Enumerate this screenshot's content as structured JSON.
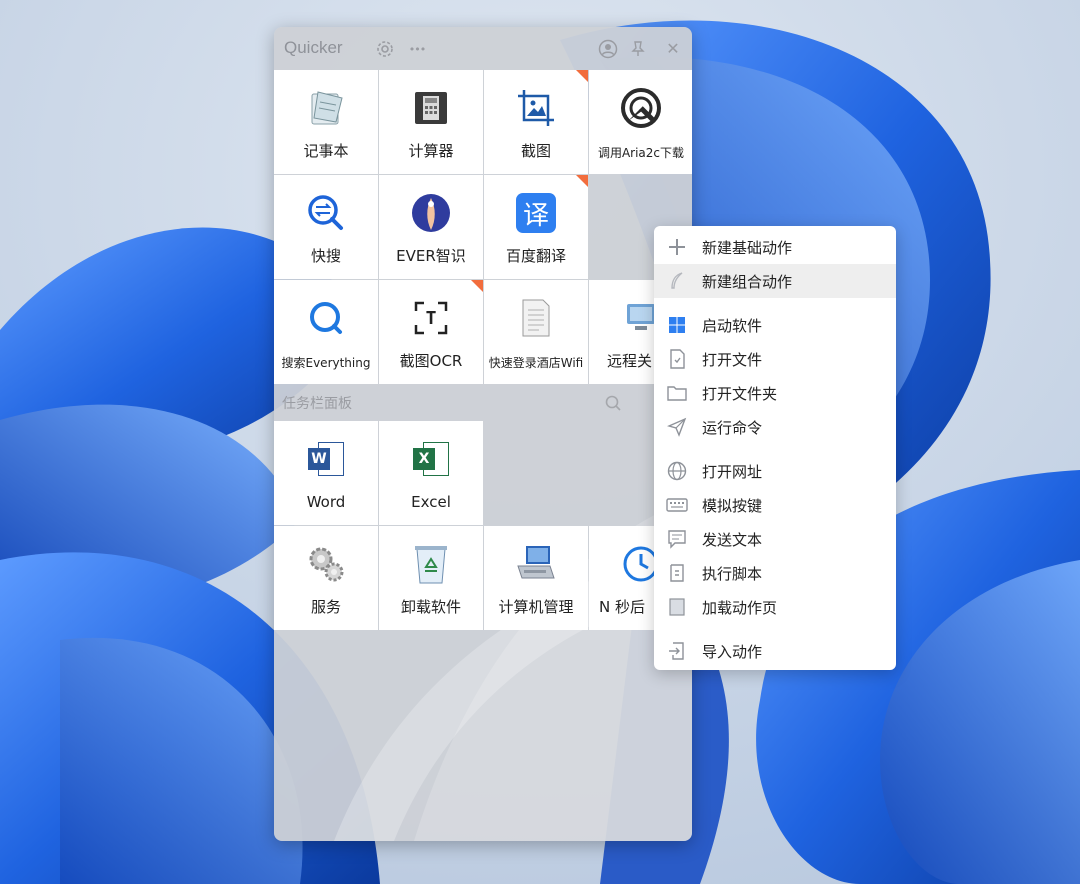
{
  "window": {
    "title": "Quicker",
    "icons": [
      "gear-icon",
      "more-icon",
      "profile-icon",
      "pin-icon",
      "close-icon"
    ],
    "more_glyph": "•••",
    "close_glyph": "✕"
  },
  "actions": [
    {
      "label": "记事本",
      "icon": "notepad-icon"
    },
    {
      "label": "计算器",
      "icon": "calculator-icon"
    },
    {
      "label": "截图",
      "icon": "screenshot-icon"
    },
    {
      "label": "调用Aria2c下载",
      "icon": "aria2c-download-icon"
    },
    {
      "label": "快搜",
      "icon": "quick-search-icon"
    },
    {
      "label": "EVER智识",
      "icon": "ever-icon"
    },
    {
      "label": "百度翻译",
      "icon": "baidu-translate-icon",
      "glyph": "译"
    },
    {
      "label": "搜索Everything",
      "icon": "everything-search-icon"
    },
    {
      "label": "截图OCR",
      "icon": "ocr-icon",
      "glyph": "T"
    },
    {
      "label": "快速登录酒店Wifi",
      "icon": "document-icon"
    },
    {
      "label": "远程关",
      "icon": "remote-icon"
    }
  ],
  "taskbar_panel": {
    "title": "任务栏面板",
    "items": [
      {
        "label": "Word",
        "icon": "word-icon",
        "glyph": "W"
      },
      {
        "label": "Excel",
        "icon": "excel-icon",
        "glyph": "X"
      },
      {
        "label": "服务",
        "icon": "services-gear-icon"
      },
      {
        "label": "卸载软件",
        "icon": "recycle-bin-icon"
      },
      {
        "label": "计算机管理",
        "icon": "computer-management-icon"
      },
      {
        "label": "N 秒后",
        "icon": "clock-icon"
      }
    ]
  },
  "context_menu": {
    "items": [
      {
        "label": "新建基础动作",
        "icon": "plus-icon"
      },
      {
        "label": "新建组合动作",
        "icon": "feather-icon",
        "highlighted": true
      },
      {
        "label": "启动软件",
        "icon": "windows-icon"
      },
      {
        "label": "打开文件",
        "icon": "file-icon"
      },
      {
        "label": "打开文件夹",
        "icon": "folder-icon"
      },
      {
        "label": "运行命令",
        "icon": "send-icon"
      },
      {
        "label": "打开网址",
        "icon": "globe-icon"
      },
      {
        "label": "模拟按键",
        "icon": "keyboard-icon"
      },
      {
        "label": "发送文本",
        "icon": "message-icon"
      },
      {
        "label": "执行脚本",
        "icon": "script-icon"
      },
      {
        "label": "加载动作页",
        "icon": "page-icon"
      },
      {
        "label": "导入动作",
        "icon": "import-icon"
      }
    ]
  },
  "colors": {
    "accent_blue": "#1e64d8",
    "badge_orange": "#f26d3d",
    "word_blue": "#2b579a",
    "excel_green": "#217346"
  }
}
